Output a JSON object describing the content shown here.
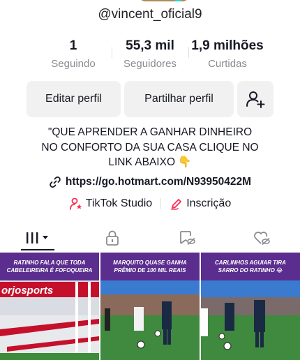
{
  "profile": {
    "username": "@vincent_oficial9",
    "stats": {
      "following_count": "1",
      "following_label": "Seguindo",
      "followers_count": "55,3 mil",
      "followers_label": "Seguidores",
      "likes_count": "1,9 milhões",
      "likes_label": "Curtidas"
    },
    "buttons": {
      "edit": "Editar perfil",
      "share": "Partilhar perfil"
    },
    "bio_lines": [
      "\"QUE APRENDER A GANHAR DINHEIRO",
      "NO CONFORTO DA SUA CASA CLIQUE NO",
      "LINK ABAIXO 👇"
    ],
    "link": "https://go.hotmart.com/N93950422M",
    "apps": {
      "studio": "TikTok Studio",
      "signup": "Inscrição"
    }
  },
  "tabs": [
    {
      "name": "videos-tab",
      "icon": "grid-bars-icon",
      "active": true
    },
    {
      "name": "private-tab",
      "icon": "lock-icon",
      "active": false
    },
    {
      "name": "reposts-tab",
      "icon": "hidden-repost-icon",
      "active": false
    },
    {
      "name": "liked-tab",
      "icon": "hidden-heart-icon",
      "active": false
    }
  ],
  "videos": [
    {
      "caption": "RATINHO FALA QUE TODA CABELEIREIRA É FOFOQUEIRA",
      "banner": "orjosports"
    },
    {
      "caption": "MARQUITO QUASE GANHA PRÊMIO DE 100 MIL REAIS"
    },
    {
      "caption": "CARLINHOS AGUIAR TIRA SARRO DO RATINHO 😂"
    }
  ],
  "colors": {
    "text": "#161823",
    "muted": "#8a8b91",
    "button_bg": "#f1f1f2",
    "caption_bg": "#5b2d8e",
    "studio_accent": "#fe2c55"
  }
}
